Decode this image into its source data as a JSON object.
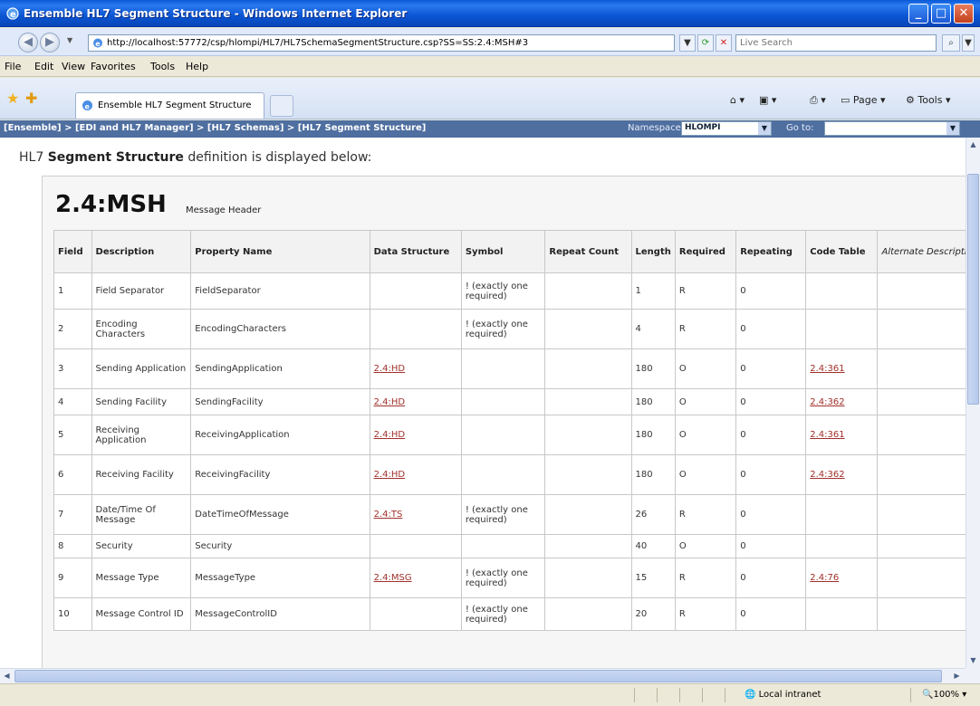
{
  "window": {
    "title": "Ensemble HL7 Segment Structure - Windows Internet Explorer"
  },
  "address": {
    "url": "http://localhost:57772/csp/hlompi/HL7/HL7SchemaSegmentStructure.csp?SS=SS:2.4:MSH#3",
    "search_placeholder": "Live Search"
  },
  "menu": [
    "File",
    "Edit",
    "View",
    "Favorites",
    "Tools",
    "Help"
  ],
  "tab": {
    "label": "Ensemble HL7 Segment Structure"
  },
  "commands": {
    "page": "Page",
    "tools": "Tools"
  },
  "breadcrumb": {
    "items": [
      "[Ensemble]",
      "[EDI and HL7 Manager]",
      "[HL7 Schemas]",
      "[HL7 Segment Structure]"
    ],
    "separator": " > "
  },
  "namespace": {
    "label": "Namespace",
    "value": "HLOMPI"
  },
  "goto": {
    "label": "Go to:"
  },
  "intro": {
    "prefix": "HL7 ",
    "bold": "Segment Structure",
    "suffix": " definition is displayed below:"
  },
  "segment": {
    "name": "2.4:MSH",
    "description": "Message Header"
  },
  "table": {
    "columns": [
      "Field",
      "Description",
      "Property Name",
      "Data Structure",
      "Symbol",
      "Repeat Count",
      "Length",
      "Required",
      "Repeating",
      "Code Table",
      "Alternate Description"
    ],
    "rows": [
      {
        "field": "1",
        "description": "Field Separator",
        "property": "FieldSeparator",
        "data_structure": "",
        "symbol": "! (exactly one required)",
        "repeat_count": "",
        "length": "1",
        "required": "R",
        "repeating": "0",
        "code_table": ""
      },
      {
        "field": "2",
        "description": "Encoding Characters",
        "property": "EncodingCharacters",
        "data_structure": "",
        "symbol": "! (exactly one required)",
        "repeat_count": "",
        "length": "4",
        "required": "R",
        "repeating": "0",
        "code_table": ""
      },
      {
        "field": "3",
        "description": "Sending Application",
        "property": "SendingApplication",
        "data_structure": "2.4:HD",
        "symbol": "",
        "repeat_count": "",
        "length": "180",
        "required": "O",
        "repeating": "0",
        "code_table": "2.4:361"
      },
      {
        "field": "4",
        "description": "Sending Facility",
        "property": "SendingFacility",
        "data_structure": "2.4:HD",
        "symbol": "",
        "repeat_count": "",
        "length": "180",
        "required": "O",
        "repeating": "0",
        "code_table": "2.4:362"
      },
      {
        "field": "5",
        "description": "Receiving Application",
        "property": "ReceivingApplication",
        "data_structure": "2.4:HD",
        "symbol": "",
        "repeat_count": "",
        "length": "180",
        "required": "O",
        "repeating": "0",
        "code_table": "2.4:361"
      },
      {
        "field": "6",
        "description": "Receiving Facility",
        "property": "ReceivingFacility",
        "data_structure": "2.4:HD",
        "symbol": "",
        "repeat_count": "",
        "length": "180",
        "required": "O",
        "repeating": "0",
        "code_table": "2.4:362"
      },
      {
        "field": "7",
        "description": "Date/Time Of Message",
        "property": "DateTimeOfMessage",
        "data_structure": "2.4:TS",
        "symbol": "! (exactly one required)",
        "repeat_count": "",
        "length": "26",
        "required": "R",
        "repeating": "0",
        "code_table": ""
      },
      {
        "field": "8",
        "description": "Security",
        "property": "Security",
        "data_structure": "",
        "symbol": "",
        "repeat_count": "",
        "length": "40",
        "required": "O",
        "repeating": "0",
        "code_table": ""
      },
      {
        "field": "9",
        "description": "Message Type",
        "property": "MessageType",
        "data_structure": "2.4:MSG",
        "symbol": "! (exactly one required)",
        "repeat_count": "",
        "length": "15",
        "required": "R",
        "repeating": "0",
        "code_table": "2.4:76"
      },
      {
        "field": "10",
        "description": "Message Control ID",
        "property": "MessageControlID",
        "data_structure": "",
        "symbol": "! (exactly one required)",
        "repeat_count": "",
        "length": "20",
        "required": "R",
        "repeating": "0",
        "code_table": ""
      }
    ]
  },
  "status": {
    "zone": "Local intranet",
    "zoom": "100%"
  },
  "colors": {
    "titlebar": "#0a5ad8",
    "breadcrumb_bg": "#4f6fa0",
    "link": "#a0302b"
  }
}
